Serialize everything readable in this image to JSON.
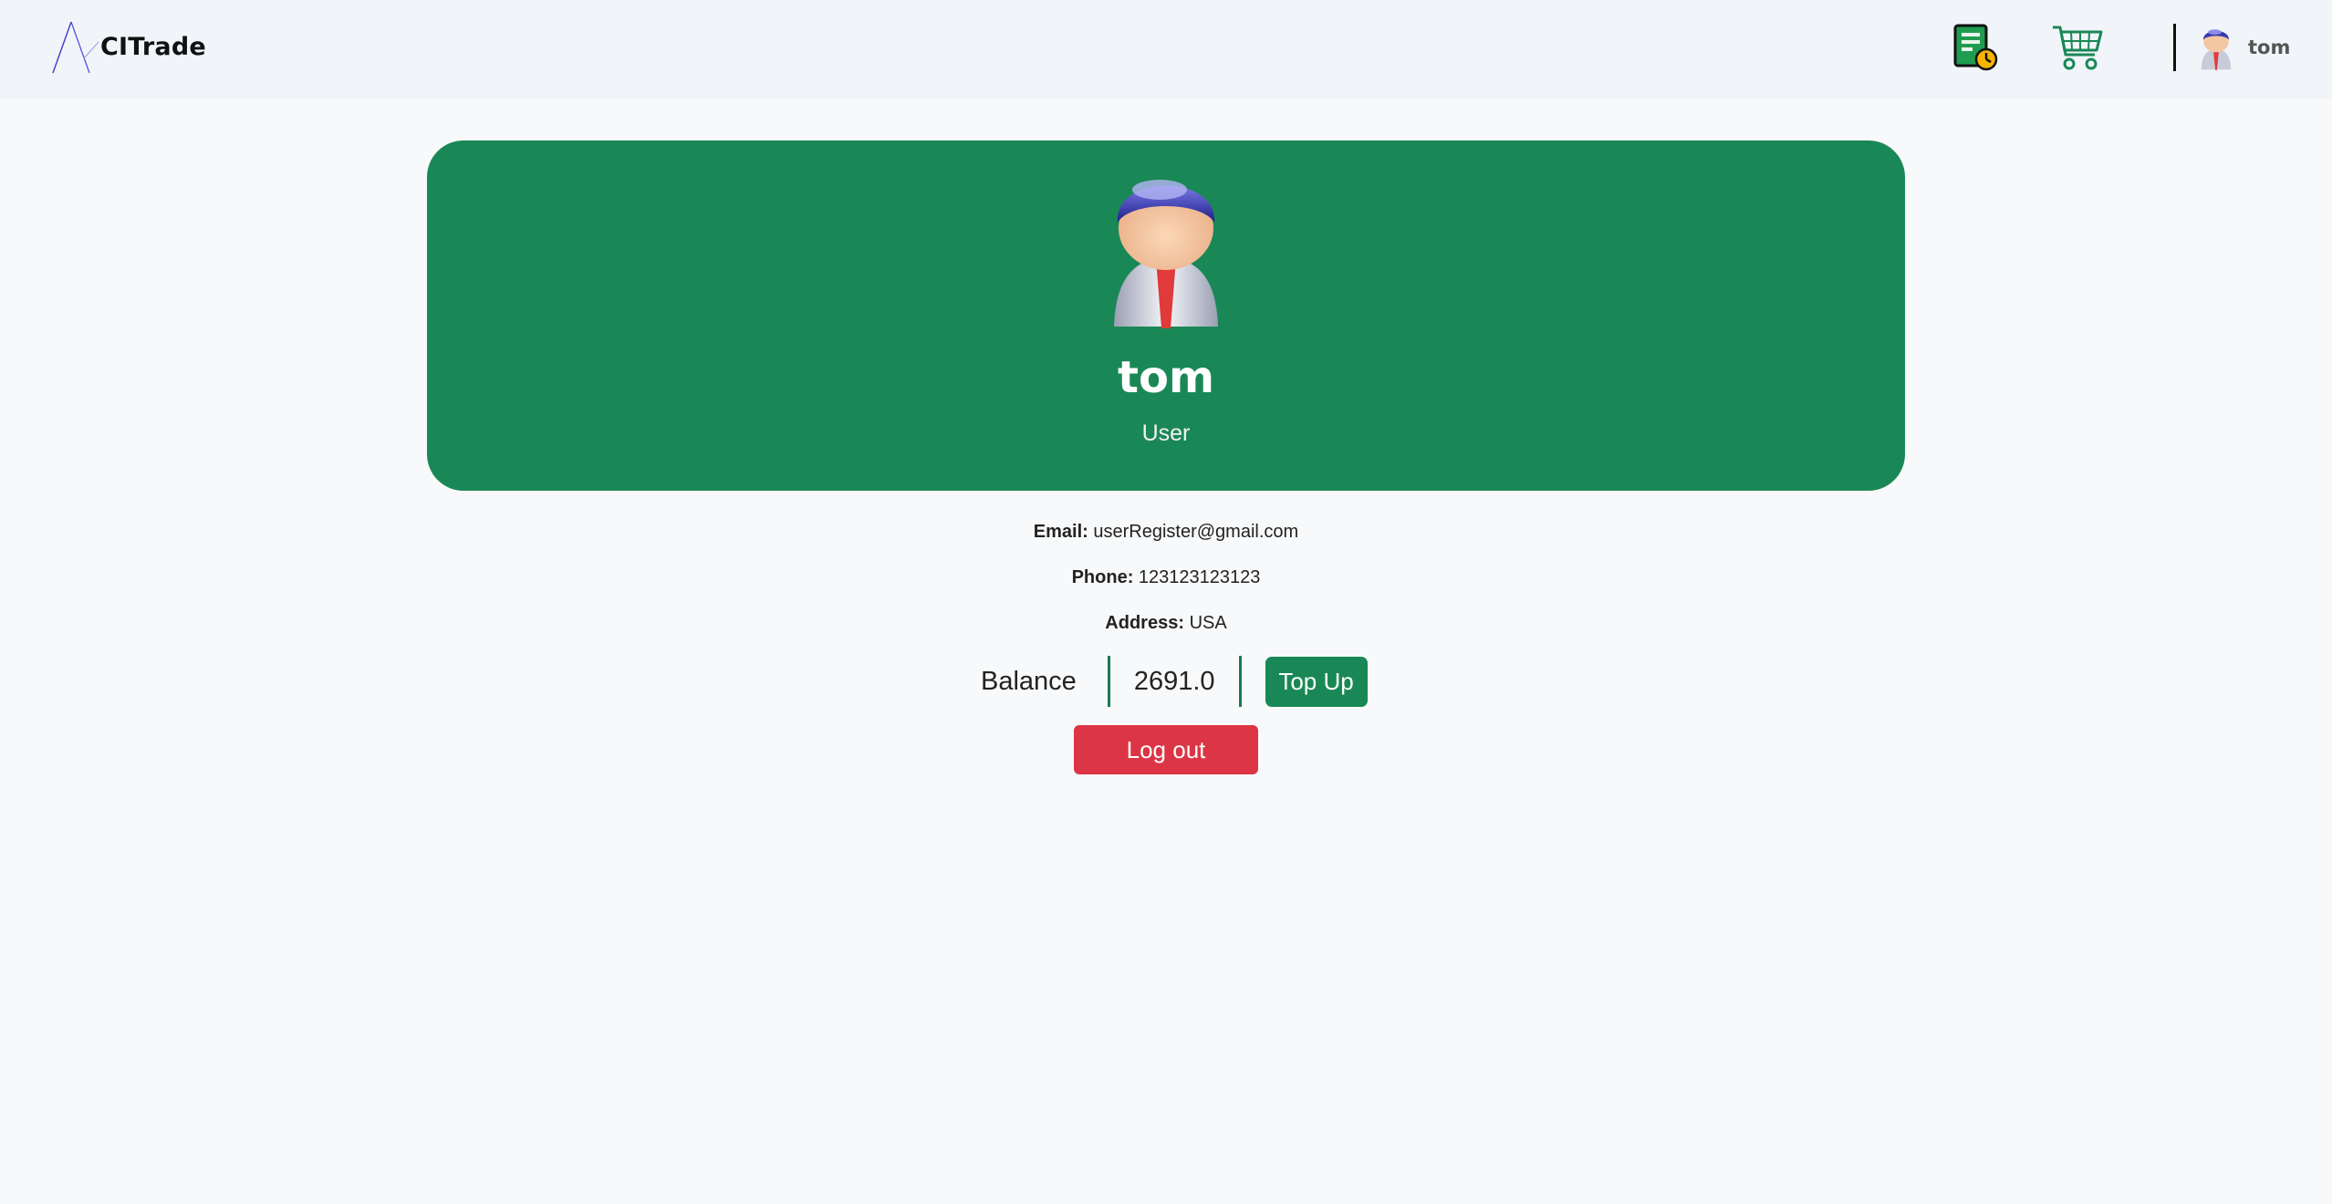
{
  "navbar": {
    "brand": "CITrade",
    "orders_icon": "order-history-icon",
    "cart_icon": "shopping-cart-icon",
    "username": "tom"
  },
  "profile": {
    "name": "tom",
    "role": "User"
  },
  "details": {
    "email_label": "Email:",
    "email": "userRegister@gmail.com",
    "phone_label": "Phone:",
    "phone": "123123123123",
    "address_label": "Address:",
    "address": "USA"
  },
  "balance": {
    "label": "Balance",
    "value": "2691.0",
    "topup_label": "Top Up"
  },
  "actions": {
    "logout_label": "Log out"
  },
  "colors": {
    "primary": "#1a8856",
    "danger": "#dc3545",
    "navbar_bg": "#f1f4f9",
    "page_bg": "#f8f9fa"
  }
}
